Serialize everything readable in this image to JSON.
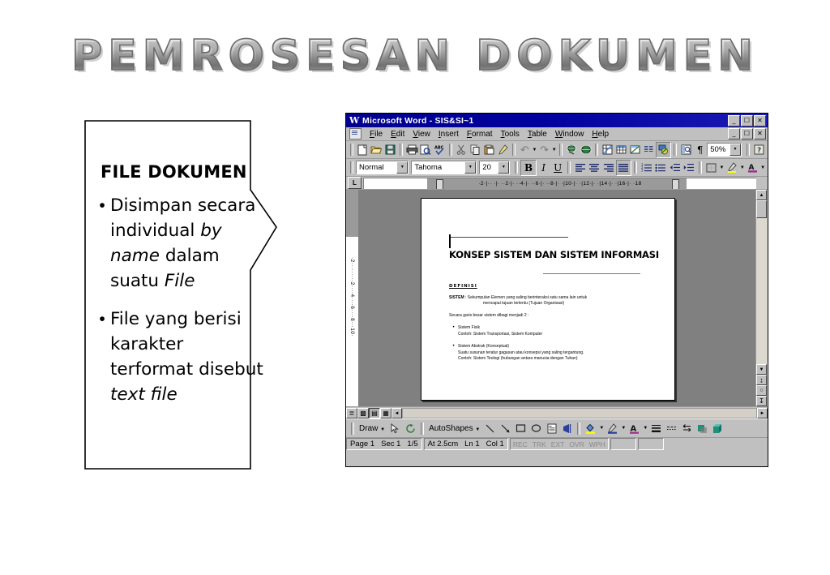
{
  "slide": {
    "title": "PEMROSESAN DOKUMEN"
  },
  "callout": {
    "heading": "FILE DOKUMEN",
    "bullets": [
      {
        "marker": "•",
        "parts": [
          {
            "text": "Disimpan secara individual ",
            "italic": false
          },
          {
            "text": "by name",
            "italic": true
          },
          {
            "text": " dalam suatu ",
            "italic": false
          },
          {
            "text": "File",
            "italic": true
          }
        ]
      },
      {
        "marker": "•",
        "parts": [
          {
            "text": "File yang berisi karakter terformat disebut ",
            "italic": false
          },
          {
            "text": "text file",
            "italic": true
          }
        ]
      }
    ]
  },
  "word": {
    "title_bar": {
      "app_icon": "W",
      "title": "Microsoft Word - SIS&SI~1",
      "buttons": [
        {
          "name": "minimize",
          "glyph": "–"
        },
        {
          "name": "restore",
          "glyph": "❐"
        },
        {
          "name": "close",
          "glyph": "✕"
        }
      ]
    },
    "menu_bar": {
      "doc_icon": "document-icon",
      "items": [
        "File",
        "Edit",
        "View",
        "Insert",
        "Format",
        "Tools",
        "Table",
        "Window",
        "Help"
      ],
      "buttons": [
        {
          "name": "minimize-doc",
          "glyph": "–"
        },
        {
          "name": "restore-doc",
          "glyph": "❐"
        },
        {
          "name": "close-doc",
          "glyph": "✕"
        }
      ]
    },
    "standard_toolbar": [
      {
        "name": "new-icon",
        "glyph": "὜B"
      },
      {
        "name": "open-icon",
        "glyph": "Ὄ2"
      },
      {
        "name": "save-icon",
        "glyph": "ὋE"
      },
      {
        "name": "print-icon",
        "glyph": "὚8"
      },
      {
        "name": "print-preview-icon",
        "glyph": "ὐE"
      },
      {
        "name": "spelling-icon",
        "glyph": "ABC"
      },
      {
        "name": "cut-icon",
        "glyph": "✂"
      },
      {
        "name": "copy-icon",
        "glyph": "⧉"
      },
      {
        "name": "paste-icon",
        "glyph": "ὌB"
      },
      {
        "name": "format-painter-icon",
        "glyph": "὘C"
      },
      {
        "name": "undo-icon",
        "glyph": "↶"
      },
      {
        "name": "redo-icon",
        "glyph": "↷"
      },
      {
        "name": "insert-hyperlink-icon",
        "glyph": "ἰD"
      },
      {
        "name": "web-toolbar-icon",
        "glyph": "ἱ0"
      },
      {
        "name": "tables-and-borders-icon",
        "glyph": "⊞"
      },
      {
        "name": "insert-table-icon",
        "glyph": "▦"
      },
      {
        "name": "insert-excel-worksheet-icon",
        "glyph": "▨"
      },
      {
        "name": "columns-icon",
        "glyph": "☰"
      },
      {
        "name": "drawing-icon",
        "glyph": "◢"
      },
      {
        "name": "document-map-icon",
        "glyph": "ὐD"
      },
      {
        "name": "show-hide-paragraph-icon",
        "glyph": "¶"
      },
      {
        "name": "help-icon",
        "glyph": "?"
      }
    ],
    "zoom_value": "50%",
    "formatting_toolbar": {
      "style": "Normal",
      "font": "Tahoma",
      "size": "20",
      "bold": "B",
      "italic": "I",
      "underline": "U",
      "align": [
        "align-left",
        "align-center",
        "align-right",
        "align-justify"
      ],
      "lists": [
        "numbered-list",
        "bulleted-list",
        "decrease-indent",
        "increase-indent"
      ],
      "colors": [
        "borders",
        "highlight",
        "font-color"
      ]
    },
    "ruler": {
      "tab_selector": "L",
      "h_labels": "·2·|·· ·|· ··2·|· ··4·|· ··6·|· ··8·|· ·|10·|· ·|12·|· ·|14·|· ·|16·|· ·18",
      "v_labels": "·2·········2····4····6····8···10·"
    },
    "document": {
      "title": "KONSEP SISTEM DAN SISTEM INFORMASI",
      "section_heading": "DEFINISI",
      "definition_label": "SISTEM",
      "definition_text": ": Sekumpulan Elemen yang saling berinteraksi satu sama lain untuk",
      "definition_text2": "mencapai tujuan tertentu (Tujuan Organisasi)",
      "intro": "Secara garis besar sistem dibagi menjadi 2 :",
      "items": [
        {
          "marker": "•",
          "lines": [
            "Sistem Fisik",
            "Contoh: Sistem Transportasi, Sistem Komputer"
          ]
        },
        {
          "marker": "•",
          "lines": [
            "Sistem Abstrak (Konseptual)",
            "Suatu susunan teratur gagasan atau konsepsi yang saling tergantung.",
            "Contoh: Sistem Teologi (hubungan antara manusia dengan Tuhan)"
          ]
        }
      ]
    },
    "view_buttons": [
      {
        "name": "normal-view",
        "glyph": "≡"
      },
      {
        "name": "web-layout-view",
        "glyph": "▥"
      },
      {
        "name": "print-layout-view",
        "glyph": "▤"
      },
      {
        "name": "outline-view",
        "glyph": "≣"
      }
    ],
    "scrollbar": {
      "up": "▲",
      "down": "▼",
      "left": "◄",
      "right": "►",
      "prev_page": "⤒",
      "select_browse_object": "○",
      "next_page": "⤓"
    },
    "drawing_toolbar": {
      "draw_label": "Draw",
      "autoshapes_label": "AutoShapes",
      "items": [
        {
          "name": "select-objects-icon",
          "glyph": "↖"
        },
        {
          "name": "free-rotate-icon",
          "glyph": "↻"
        },
        {
          "name": "line-icon",
          "glyph": "╲"
        },
        {
          "name": "arrow-icon",
          "glyph": "↘"
        },
        {
          "name": "rectangle-icon",
          "glyph": "□"
        },
        {
          "name": "oval-icon",
          "glyph": "○"
        },
        {
          "name": "text-box-icon",
          "glyph": "▤"
        },
        {
          "name": "insert-wordart-icon",
          "glyph": "◁"
        },
        {
          "name": "fill-color-icon",
          "glyph": "ἿA"
        },
        {
          "name": "line-color-icon",
          "glyph": "✎"
        },
        {
          "name": "font-color-icon",
          "glyph": "A"
        },
        {
          "name": "line-style-icon",
          "glyph": "☰"
        },
        {
          "name": "dash-style-icon",
          "glyph": "┅"
        },
        {
          "name": "arrow-style-icon",
          "glyph": "⇄"
        },
        {
          "name": "shadow-icon",
          "glyph": "■"
        },
        {
          "name": "3d-icon",
          "glyph": "◖"
        }
      ]
    },
    "status_bar": {
      "page": "Page 1",
      "section": "Sec 1",
      "pages": "1/5",
      "at": "At 2.5cm",
      "line": "Ln 1",
      "column": "Col 1",
      "indicators": [
        "REC",
        "TRK",
        "EXT",
        "OVR",
        "WPH"
      ]
    }
  },
  "colors": {
    "titlebar": "#00008c",
    "chrome": "#c0c0c0",
    "canvas": "#808080",
    "page": "#ffffff"
  }
}
